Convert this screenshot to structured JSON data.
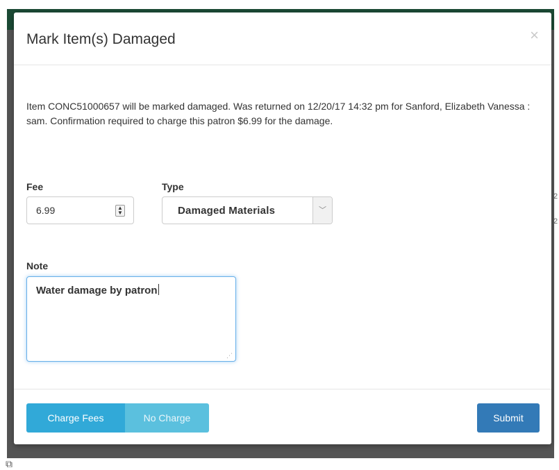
{
  "modal": {
    "title": "Mark Item(s) Damaged",
    "close_label": "×",
    "message": "Item CONC51000657 will be marked damaged. Was returned on 12/20/17 14:32 pm for Sanford, Elizabeth Vanessa : sam. Confirmation required to charge this patron $6.99 for the damage."
  },
  "form": {
    "fee": {
      "label": "Fee",
      "value": "6.99"
    },
    "type": {
      "label": "Type",
      "selected": "Damaged Materials"
    },
    "note": {
      "label": "Note",
      "value": "Water damage by patron"
    }
  },
  "footer": {
    "charge_fees_label": "Charge Fees",
    "no_charge_label": "No Charge",
    "submit_label": "Submit"
  },
  "background": {
    "peek_text_1": "2",
    "peek_text_2": "2"
  },
  "colors": {
    "topbar": "#1b4a35",
    "primary": "#337ab7",
    "info": "#5bc0de",
    "info_active": "#31a9d8"
  }
}
